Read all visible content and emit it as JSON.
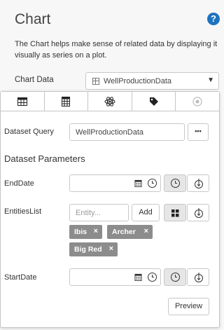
{
  "header": {
    "title": "Chart",
    "help_icon": "question-circle-icon",
    "description": "The Chart helps make sense of related data by displaying it visually as series on a plot."
  },
  "chart_data_field": {
    "label": "Chart Data",
    "value": "WellProductionData",
    "icon": "table-icon"
  },
  "tabs": [
    {
      "name": "data-tab",
      "icon": "table-icon",
      "active": true
    },
    {
      "name": "calculator-tab",
      "icon": "calculator-icon",
      "active": false
    },
    {
      "name": "series-tab",
      "icon": "atom-icon",
      "active": false
    },
    {
      "name": "tag-tab",
      "icon": "tag-icon",
      "active": false
    },
    {
      "name": "other-tab",
      "icon": "circle-dot-icon",
      "active": false
    }
  ],
  "dataset_query": {
    "label": "Dataset Query",
    "value": "WellProductionData",
    "more_label": "•••"
  },
  "dataset_parameters": {
    "title": "Dataset Parameters",
    "end_date": {
      "label": "EndDate",
      "value": ""
    },
    "entities_list": {
      "label": "EntitiesList",
      "placeholder": "Entity...",
      "add_label": "Add",
      "chips": [
        "Ibis",
        "Archer",
        "Big Red"
      ]
    },
    "start_date": {
      "label": "StartDate",
      "value": ""
    }
  },
  "preview_label": "Preview",
  "colors": {
    "accent": "#1e73be",
    "chip": "#8c8c8c",
    "border": "#c8c8c8"
  }
}
